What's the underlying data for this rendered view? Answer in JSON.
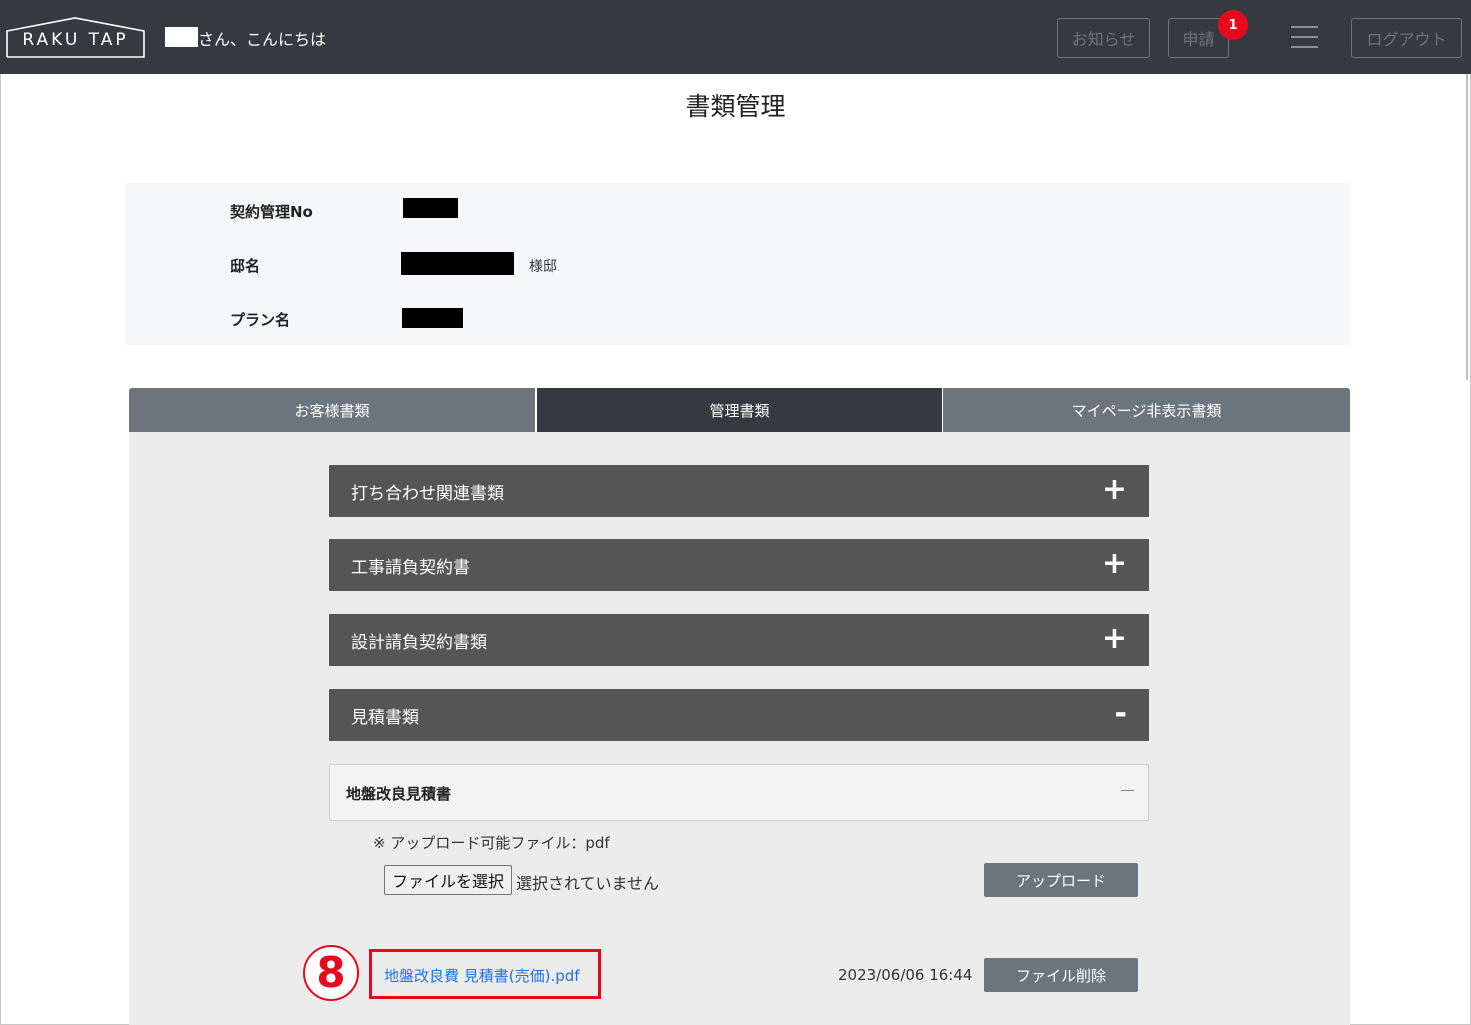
{
  "header": {
    "logo": "RAKU TAP",
    "greeting": "さん、こんにちは",
    "news_label": "お知らせ",
    "apply_label": "申請",
    "apply_badge": "1",
    "logout_label": "ログアウト"
  },
  "page": {
    "title": "書類管理"
  },
  "info": {
    "contract_no_label": "契約管理No",
    "residence_label": "邸名",
    "residence_suffix": "様邸",
    "plan_label": "プラン名"
  },
  "tabs": [
    {
      "label": "お客様書類"
    },
    {
      "label": "管理書類"
    },
    {
      "label": "マイページ非表示書類"
    }
  ],
  "accordions": [
    {
      "label": "打ち合わせ関連書類",
      "sign": "+"
    },
    {
      "label": "工事請負契約書",
      "sign": "+"
    },
    {
      "label": "設計請負契約書類",
      "sign": "+"
    },
    {
      "label": "見積書類",
      "sign": "-"
    }
  ],
  "subsection": {
    "label": "地盤改良見積書",
    "note": "※ アップロード可能ファイル：pdf",
    "choose_file_label": "ファイルを選択",
    "file_status": "選択されていません",
    "upload_label": "アップロード"
  },
  "files": [
    {
      "name": "地盤改良費 見積書(売価).pdf",
      "date": "2023/06/06 16:44",
      "delete_label": "ファイル削除"
    }
  ],
  "annotation": {
    "step": "8",
    "color": "#e8091e"
  },
  "colors": {
    "header_bg": "#343a40",
    "tab_active": "#343a40",
    "tab_inactive": "#6c757d",
    "accordion_bg": "#555555",
    "link": "#1a73e8"
  }
}
